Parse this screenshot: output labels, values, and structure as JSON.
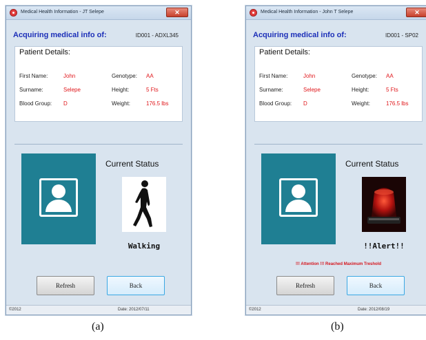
{
  "windows": [
    {
      "title": "Medical Health Information - JT Selepe",
      "close_label": "✕",
      "acquiring_label": "Acquiring medical info of:",
      "patient_id": "ID001 - ADXL345",
      "panel_title": "Patient Details:",
      "fields": {
        "first_name_label": "First Name:",
        "first_name": "John",
        "surname_label": "Surname:",
        "surname": "Selepe",
        "blood_group_label": "Blood Group:",
        "blood_group": "D",
        "genotype_label": "Genotype:",
        "genotype": "AA",
        "height_label": "Height:",
        "height": "5 Fts",
        "weight_label": "Weight:",
        "weight": "176.5 lbs"
      },
      "status_title": "Current Status",
      "status_icon": "walking-person-icon",
      "status_text": "Walking",
      "alert_message": "",
      "refresh_label": "Refresh",
      "back_label": "Back",
      "status_left": "©2012",
      "status_date": "Date: 2012/07/11",
      "caption": "(a)"
    },
    {
      "title": "Medical Health Information - John T Selepe",
      "close_label": "✕",
      "acquiring_label": "Acquiring medical info of:",
      "patient_id": "ID001 - SP02",
      "panel_title": "Patient Details:",
      "fields": {
        "first_name_label": "First Name:",
        "first_name": "John",
        "surname_label": "Surname:",
        "surname": "Selepe",
        "blood_group_label": "Blood Group:",
        "blood_group": "D",
        "genotype_label": "Genotype:",
        "genotype": "AA",
        "height_label": "Height:",
        "height": "5 Fts",
        "weight_label": "Weight:",
        "weight": "176.5 lbs"
      },
      "status_title": "Current Status",
      "status_icon": "alarm-beacon-icon",
      "status_text": "!!Alert!!",
      "alert_message": "!!! Attention !!! Reached Maximum Treshold",
      "refresh_label": "Refresh",
      "back_label": "Back",
      "status_left": "©2012",
      "status_date": "Date: 2012/08/19",
      "caption": "(b)"
    }
  ],
  "colors": {
    "accent_blue": "#1c2fb8",
    "value_red": "#e0171b",
    "avatar_teal": "#1f7f93"
  }
}
